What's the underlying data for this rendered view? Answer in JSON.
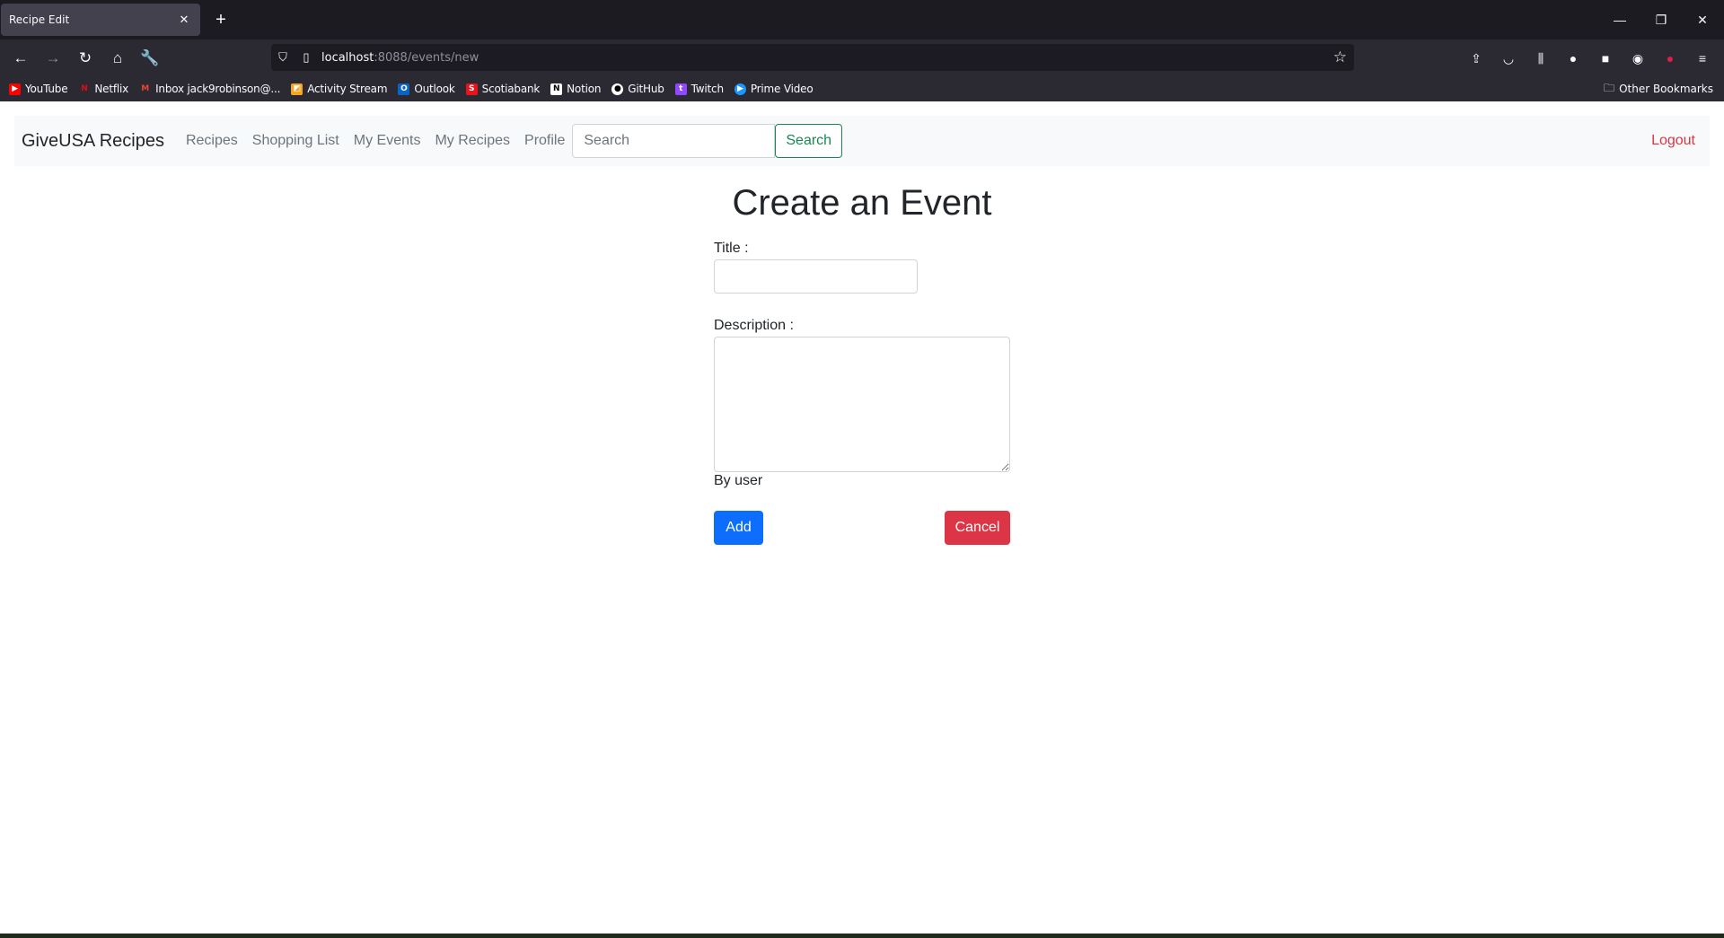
{
  "browser": {
    "tab_title": "Recipe Edit",
    "tab_close": "✕",
    "new_tab": "+",
    "url_host": "localhost",
    "url_rest": ":8088/events/new",
    "bookmarks": [
      {
        "label": "YouTube",
        "icon": "youtube-icon",
        "color": "#ff0000"
      },
      {
        "label": "Netflix",
        "icon": "netflix-icon",
        "color": "#e50914"
      },
      {
        "label": "Inbox jack9robinson@...",
        "icon": "gmail-icon",
        "color": "#ea4335"
      },
      {
        "label": "Activity Stream",
        "icon": "activity-stream-icon",
        "color": "#f5a623"
      },
      {
        "label": "Outlook",
        "icon": "outlook-icon",
        "color": "#0a64c8"
      },
      {
        "label": "Scotiabank",
        "icon": "scotiabank-icon",
        "color": "#ec111a"
      },
      {
        "label": "Notion",
        "icon": "notion-icon",
        "color": "#ffffff"
      },
      {
        "label": "GitHub",
        "icon": "github-icon",
        "color": "#ffffff"
      },
      {
        "label": "Twitch",
        "icon": "twitch-icon",
        "color": "#9146ff"
      },
      {
        "label": "Prime Video",
        "icon": "prime-video-icon",
        "color": "#1a98ff"
      }
    ],
    "other_bookmarks": "Other Bookmarks"
  },
  "site": {
    "brand": "GiveUSA Recipes",
    "nav_links": [
      "Recipes",
      "Shopping List",
      "My Events",
      "My Recipes",
      "Profile"
    ],
    "search_placeholder": "Search",
    "search_button": "Search",
    "logout": "Logout"
  },
  "form": {
    "heading": "Create an Event",
    "title_label": "Title :",
    "title_value": "",
    "description_label": "Description :",
    "description_value": "",
    "by_user": "By user",
    "add_button": "Add",
    "cancel_button": "Cancel"
  },
  "colors": {
    "primary": "#0d6efd",
    "danger": "#dc3545",
    "success": "#198754"
  }
}
